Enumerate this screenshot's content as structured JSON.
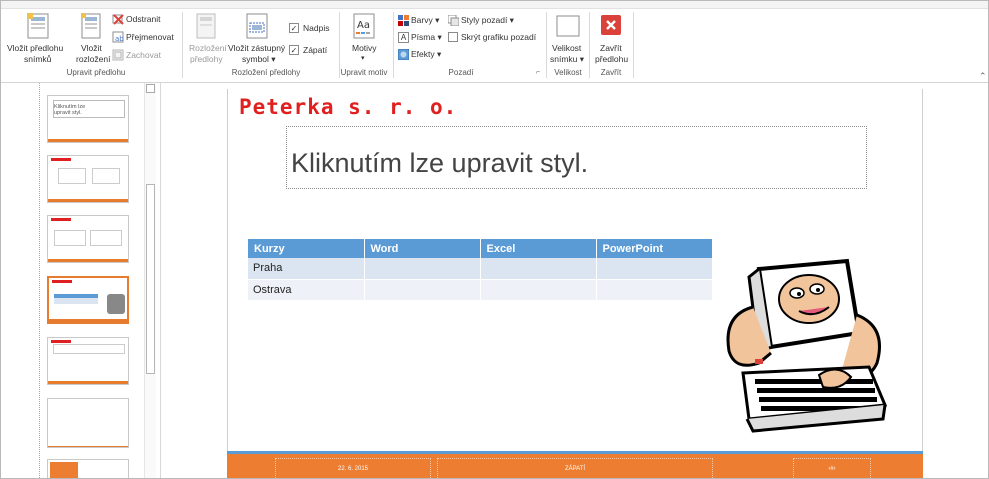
{
  "ribbon": {
    "groups": {
      "edit_master": "Upravit předlohu",
      "master_layout": "Rozložení předlohy",
      "edit_theme": "Upravit motiv",
      "background": "Pozadí",
      "size": "Velikost",
      "close": "Zavřít"
    },
    "insert_master": [
      "Vložit předlohu",
      "snímků"
    ],
    "insert_layout": [
      "Vložit",
      "rozložení"
    ],
    "delete": "Odstranit",
    "rename": "Přejmenovat",
    "preserve": "Zachovat",
    "master_layout_btn": [
      "Rozložení",
      "předlohy"
    ],
    "insert_placeholder": [
      "Vložit zástupný",
      "symbol ▾"
    ],
    "title_check": "Nadpis",
    "footers_check": "Zápatí",
    "themes": "Motivy",
    "colors": "Barvy ▾",
    "fonts": "Písma ▾",
    "effects": "Efekty ▾",
    "bg_styles": "Styly pozadí ▾",
    "hide_bg": "Skrýt grafiku pozadí",
    "slide_size": [
      "Velikost",
      "snímku ▾"
    ],
    "close_master": [
      "Zavřít",
      "předlohu"
    ]
  },
  "thumbnails": [
    {
      "text": "Kliknutím lze upravit styl."
    },
    {
      "text": ""
    },
    {
      "text": ""
    },
    {
      "text": ""
    },
    {
      "text": ""
    },
    {
      "text": ""
    },
    {
      "text": ""
    }
  ],
  "slide": {
    "company": "Peterka s. r. o.",
    "title": "Kliknutím lze upravit styl.",
    "table": {
      "headers": [
        "Kurzy",
        "Word",
        "Excel",
        "PowerPoint"
      ],
      "rows": [
        [
          "Praha",
          "",
          "",
          ""
        ],
        [
          "Ostrava",
          "",
          "",
          ""
        ]
      ]
    },
    "footer": {
      "date": "22. 6. 2015",
      "text": "ZÁPATÍ",
      "number": "‹#›"
    }
  },
  "colors": {
    "accent_orange": "#ED7D31",
    "table_blue": "#5B9BD5",
    "company_red": "#E02020",
    "close_red": "#D9413A"
  }
}
